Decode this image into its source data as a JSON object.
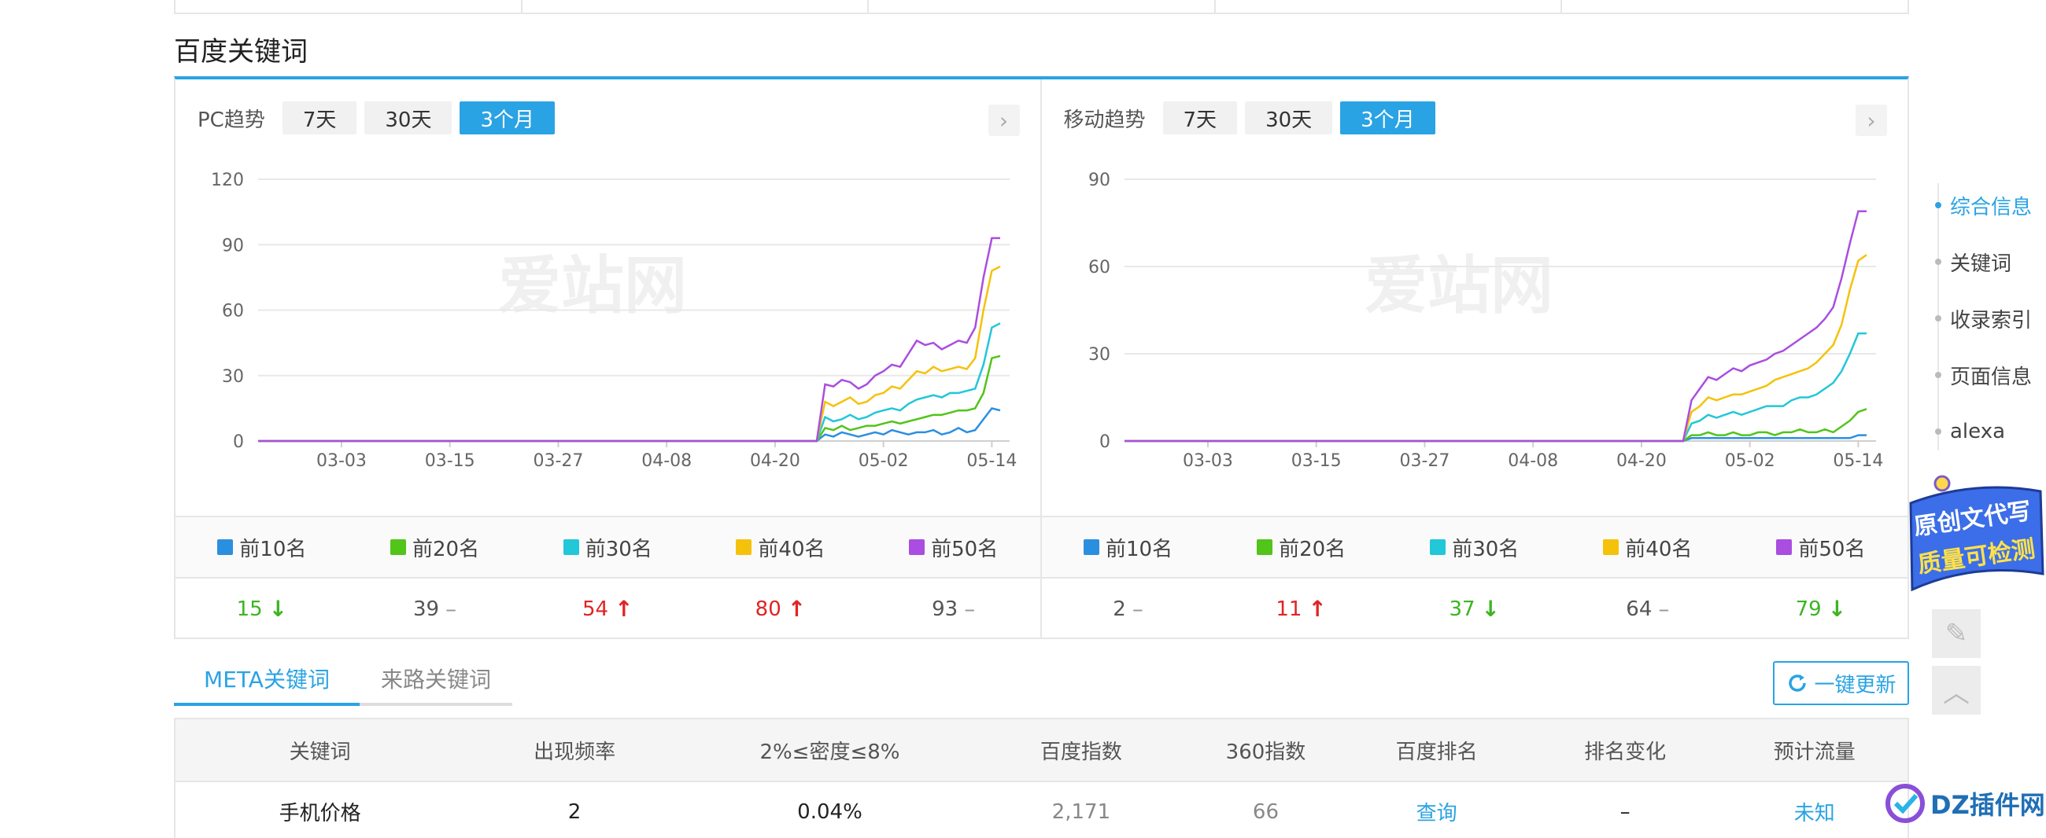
{
  "section_title": "百度关键词",
  "pc_panel": {
    "label": "PC趋势",
    "tabs": [
      "7天",
      "30天",
      "3个月"
    ],
    "active_tab": 2,
    "watermark": "爱站网",
    "legend": [
      "前10名",
      "前20名",
      "前30名",
      "前40名",
      "前50名"
    ],
    "values": [
      {
        "value": "15",
        "trend": "down"
      },
      {
        "value": "39",
        "trend": "flat"
      },
      {
        "value": "54",
        "trend": "up"
      },
      {
        "value": "80",
        "trend": "up"
      },
      {
        "value": "93",
        "trend": "flat"
      }
    ]
  },
  "mobile_panel": {
    "label": "移动趋势",
    "tabs": [
      "7天",
      "30天",
      "3个月"
    ],
    "active_tab": 2,
    "watermark": "爱站网",
    "legend": [
      "前10名",
      "前20名",
      "前30名",
      "前40名",
      "前50名"
    ],
    "values": [
      {
        "value": "2",
        "trend": "flat"
      },
      {
        "value": "11",
        "trend": "up"
      },
      {
        "value": "37",
        "trend": "down"
      },
      {
        "value": "64",
        "trend": "flat"
      },
      {
        "value": "79",
        "trend": "down"
      }
    ]
  },
  "colors": {
    "accent": "#2aa3e4",
    "series": [
      "#2b8fe0",
      "#52c41a",
      "#22c7d8",
      "#f5c20b",
      "#a94ee0"
    ],
    "up": "#e02424",
    "down": "#3cb521",
    "flat": "#999999"
  },
  "chart_data": [
    {
      "type": "line",
      "title": "PC趋势",
      "x_ticks": [
        "03-03",
        "03-15",
        "03-27",
        "04-08",
        "04-20",
        "05-02",
        "05-14"
      ],
      "y_ticks": [
        0,
        30,
        60,
        90,
        120
      ],
      "ylim": [
        0,
        120
      ],
      "series": [
        {
          "name": "前10名",
          "values": [
            0,
            0,
            0,
            0,
            0,
            0,
            0,
            0,
            0,
            0,
            0,
            0,
            0,
            0,
            0,
            0,
            0,
            0,
            0,
            0,
            0,
            0,
            0,
            0,
            0,
            0,
            0,
            0,
            0,
            0,
            0,
            0,
            0,
            0,
            0,
            0,
            0,
            0,
            0,
            0,
            0,
            0,
            0,
            0,
            0,
            0,
            0,
            0,
            0,
            0,
            0,
            0,
            0,
            0,
            0,
            0,
            0,
            0,
            0,
            0,
            0,
            0,
            0,
            0,
            0,
            0,
            0,
            0,
            3,
            2,
            4,
            3,
            2,
            3,
            4,
            3,
            5,
            4,
            3,
            4,
            4,
            5,
            3,
            4,
            6,
            4,
            5,
            10,
            15,
            14
          ]
        },
        {
          "name": "前20名",
          "values": [
            0,
            0,
            0,
            0,
            0,
            0,
            0,
            0,
            0,
            0,
            0,
            0,
            0,
            0,
            0,
            0,
            0,
            0,
            0,
            0,
            0,
            0,
            0,
            0,
            0,
            0,
            0,
            0,
            0,
            0,
            0,
            0,
            0,
            0,
            0,
            0,
            0,
            0,
            0,
            0,
            0,
            0,
            0,
            0,
            0,
            0,
            0,
            0,
            0,
            0,
            0,
            0,
            0,
            0,
            0,
            0,
            0,
            0,
            0,
            0,
            0,
            0,
            0,
            0,
            0,
            0,
            0,
            0,
            6,
            5,
            7,
            5,
            6,
            7,
            7,
            8,
            9,
            8,
            9,
            10,
            11,
            12,
            12,
            13,
            14,
            14,
            15,
            22,
            38,
            39
          ]
        },
        {
          "name": "前30名",
          "values": [
            0,
            0,
            0,
            0,
            0,
            0,
            0,
            0,
            0,
            0,
            0,
            0,
            0,
            0,
            0,
            0,
            0,
            0,
            0,
            0,
            0,
            0,
            0,
            0,
            0,
            0,
            0,
            0,
            0,
            0,
            0,
            0,
            0,
            0,
            0,
            0,
            0,
            0,
            0,
            0,
            0,
            0,
            0,
            0,
            0,
            0,
            0,
            0,
            0,
            0,
            0,
            0,
            0,
            0,
            0,
            0,
            0,
            0,
            0,
            0,
            0,
            0,
            0,
            0,
            0,
            0,
            0,
            0,
            11,
            9,
            10,
            12,
            10,
            11,
            13,
            14,
            15,
            14,
            17,
            19,
            20,
            21,
            20,
            22,
            22,
            23,
            24,
            35,
            52,
            54
          ]
        },
        {
          "name": "前40名",
          "values": [
            0,
            0,
            0,
            0,
            0,
            0,
            0,
            0,
            0,
            0,
            0,
            0,
            0,
            0,
            0,
            0,
            0,
            0,
            0,
            0,
            0,
            0,
            0,
            0,
            0,
            0,
            0,
            0,
            0,
            0,
            0,
            0,
            0,
            0,
            0,
            0,
            0,
            0,
            0,
            0,
            0,
            0,
            0,
            0,
            0,
            0,
            0,
            0,
            0,
            0,
            0,
            0,
            0,
            0,
            0,
            0,
            0,
            0,
            0,
            0,
            0,
            0,
            0,
            0,
            0,
            0,
            0,
            0,
            18,
            16,
            18,
            20,
            17,
            18,
            21,
            22,
            25,
            24,
            28,
            32,
            31,
            34,
            32,
            33,
            34,
            33,
            38,
            60,
            78,
            80
          ]
        },
        {
          "name": "前50名",
          "values": [
            0,
            0,
            0,
            0,
            0,
            0,
            0,
            0,
            0,
            0,
            0,
            0,
            0,
            0,
            0,
            0,
            0,
            0,
            0,
            0,
            0,
            0,
            0,
            0,
            0,
            0,
            0,
            0,
            0,
            0,
            0,
            0,
            0,
            0,
            0,
            0,
            0,
            0,
            0,
            0,
            0,
            0,
            0,
            0,
            0,
            0,
            0,
            0,
            0,
            0,
            0,
            0,
            0,
            0,
            0,
            0,
            0,
            0,
            0,
            0,
            0,
            0,
            0,
            0,
            0,
            0,
            0,
            0,
            26,
            25,
            28,
            27,
            24,
            26,
            30,
            32,
            35,
            34,
            40,
            46,
            44,
            45,
            42,
            44,
            46,
            45,
            52,
            75,
            93,
            93
          ]
        }
      ]
    },
    {
      "type": "line",
      "title": "移动趋势",
      "x_ticks": [
        "03-03",
        "03-15",
        "03-27",
        "04-08",
        "04-20",
        "05-02",
        "05-14"
      ],
      "y_ticks": [
        0,
        30,
        60,
        90
      ],
      "ylim": [
        0,
        90
      ],
      "series": [
        {
          "name": "前10名",
          "values": [
            0,
            0,
            0,
            0,
            0,
            0,
            0,
            0,
            0,
            0,
            0,
            0,
            0,
            0,
            0,
            0,
            0,
            0,
            0,
            0,
            0,
            0,
            0,
            0,
            0,
            0,
            0,
            0,
            0,
            0,
            0,
            0,
            0,
            0,
            0,
            0,
            0,
            0,
            0,
            0,
            0,
            0,
            0,
            0,
            0,
            0,
            0,
            0,
            0,
            0,
            0,
            0,
            0,
            0,
            0,
            0,
            0,
            0,
            0,
            0,
            0,
            0,
            0,
            0,
            0,
            0,
            0,
            0,
            1,
            1,
            1,
            1,
            1,
            1,
            1,
            1,
            1,
            1,
            1,
            1,
            1,
            1,
            1,
            1,
            1,
            1,
            1,
            1,
            2,
            2
          ]
        },
        {
          "name": "前20名",
          "values": [
            0,
            0,
            0,
            0,
            0,
            0,
            0,
            0,
            0,
            0,
            0,
            0,
            0,
            0,
            0,
            0,
            0,
            0,
            0,
            0,
            0,
            0,
            0,
            0,
            0,
            0,
            0,
            0,
            0,
            0,
            0,
            0,
            0,
            0,
            0,
            0,
            0,
            0,
            0,
            0,
            0,
            0,
            0,
            0,
            0,
            0,
            0,
            0,
            0,
            0,
            0,
            0,
            0,
            0,
            0,
            0,
            0,
            0,
            0,
            0,
            0,
            0,
            0,
            0,
            0,
            0,
            0,
            0,
            2,
            2,
            3,
            2,
            2,
            3,
            2,
            2,
            3,
            3,
            2,
            3,
            3,
            4,
            3,
            3,
            4,
            3,
            5,
            7,
            10,
            11
          ]
        },
        {
          "name": "前30名",
          "values": [
            0,
            0,
            0,
            0,
            0,
            0,
            0,
            0,
            0,
            0,
            0,
            0,
            0,
            0,
            0,
            0,
            0,
            0,
            0,
            0,
            0,
            0,
            0,
            0,
            0,
            0,
            0,
            0,
            0,
            0,
            0,
            0,
            0,
            0,
            0,
            0,
            0,
            0,
            0,
            0,
            0,
            0,
            0,
            0,
            0,
            0,
            0,
            0,
            0,
            0,
            0,
            0,
            0,
            0,
            0,
            0,
            0,
            0,
            0,
            0,
            0,
            0,
            0,
            0,
            0,
            0,
            0,
            0,
            6,
            7,
            9,
            8,
            9,
            10,
            9,
            10,
            11,
            12,
            12,
            12,
            14,
            15,
            15,
            16,
            18,
            20,
            24,
            30,
            37,
            37
          ]
        },
        {
          "name": "前40名",
          "values": [
            0,
            0,
            0,
            0,
            0,
            0,
            0,
            0,
            0,
            0,
            0,
            0,
            0,
            0,
            0,
            0,
            0,
            0,
            0,
            0,
            0,
            0,
            0,
            0,
            0,
            0,
            0,
            0,
            0,
            0,
            0,
            0,
            0,
            0,
            0,
            0,
            0,
            0,
            0,
            0,
            0,
            0,
            0,
            0,
            0,
            0,
            0,
            0,
            0,
            0,
            0,
            0,
            0,
            0,
            0,
            0,
            0,
            0,
            0,
            0,
            0,
            0,
            0,
            0,
            0,
            0,
            0,
            0,
            10,
            12,
            15,
            14,
            15,
            16,
            16,
            17,
            18,
            19,
            21,
            22,
            23,
            24,
            25,
            27,
            30,
            33,
            40,
            52,
            62,
            64
          ]
        },
        {
          "name": "前50名",
          "values": [
            0,
            0,
            0,
            0,
            0,
            0,
            0,
            0,
            0,
            0,
            0,
            0,
            0,
            0,
            0,
            0,
            0,
            0,
            0,
            0,
            0,
            0,
            0,
            0,
            0,
            0,
            0,
            0,
            0,
            0,
            0,
            0,
            0,
            0,
            0,
            0,
            0,
            0,
            0,
            0,
            0,
            0,
            0,
            0,
            0,
            0,
            0,
            0,
            0,
            0,
            0,
            0,
            0,
            0,
            0,
            0,
            0,
            0,
            0,
            0,
            0,
            0,
            0,
            0,
            0,
            0,
            0,
            0,
            14,
            18,
            22,
            21,
            23,
            25,
            24,
            26,
            27,
            28,
            30,
            31,
            33,
            35,
            37,
            39,
            42,
            46,
            56,
            68,
            79,
            79
          ]
        }
      ]
    }
  ],
  "keyword_tabs": [
    "META关键词",
    "来路关键词"
  ],
  "refresh_button": "一键更新",
  "table": {
    "headers": [
      "关键词",
      "出现频率",
      "2%≤密度≤8%",
      "百度指数",
      "360指数",
      "百度排名",
      "排名变化",
      "预计流量"
    ],
    "rows": [
      [
        "手机价格",
        "2",
        "0.04%",
        "2,171",
        "66",
        "查询",
        "–",
        "未知"
      ]
    ]
  },
  "side_nav": [
    "综合信息",
    "关键词",
    "收录索引",
    "页面信息",
    "alexa"
  ],
  "promo_text": [
    "原创文代写",
    "质量可检测"
  ],
  "dz_logo_text": "DZ插件网"
}
